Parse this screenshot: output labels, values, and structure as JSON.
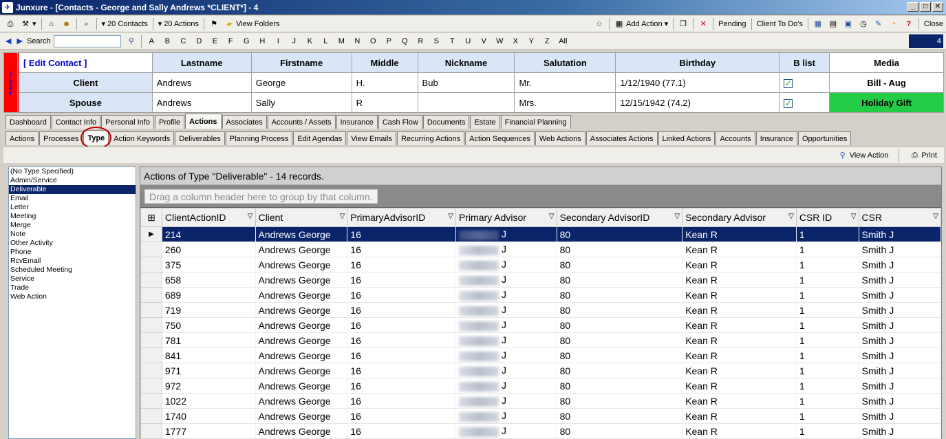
{
  "window": {
    "title": "Junxure - [Contacts - George and Sally Andrews  *CLIENT*] - 4"
  },
  "toolbar1": {
    "contacts": "20 Contacts",
    "actions": "20 Actions",
    "view_folders": "View Folders",
    "add_action": "Add Action",
    "pending": "Pending",
    "client_todos": "Client To Do's",
    "close": "Close"
  },
  "toolbar2": {
    "search_label": "Search",
    "letters": [
      "A",
      "B",
      "C",
      "D",
      "E",
      "F",
      "G",
      "H",
      "I",
      "J",
      "K",
      "L",
      "M",
      "N",
      "O",
      "P",
      "Q",
      "R",
      "S",
      "T",
      "U",
      "V",
      "W",
      "X",
      "Y",
      "Z"
    ],
    "all_label": "All",
    "counter": "4"
  },
  "contact": {
    "alert": "ALERT",
    "edit_label": "[ Edit Contact ]",
    "columns": [
      "Lastname",
      "Firstname",
      "Middle",
      "Nickname",
      "Salutation",
      "Birthday",
      "B list",
      "Media"
    ],
    "client": {
      "role": "Client",
      "last": "Andrews",
      "first": "George",
      "middle": "H.",
      "nick": "Bub",
      "salutation": "Mr.",
      "birthday": "1/12/1940 (77.1)",
      "media": "Bill - Aug"
    },
    "spouse": {
      "role": "Spouse",
      "last": "Andrews",
      "first": "Sally",
      "middle": "R",
      "nick": "",
      "salutation": "Mrs.",
      "birthday": "12/15/1942 (74.2)",
      "media": "Holiday Gift"
    }
  },
  "tabs1": [
    "Dashboard",
    "Contact Info",
    "Personal Info",
    "Profile",
    "Actions",
    "Associates",
    "Accounts / Assets",
    "Insurance",
    "Cash Flow",
    "Documents",
    "Estate",
    "Financial Planning"
  ],
  "tabs2": [
    "Actions",
    "Processes",
    "Type",
    "Action Keywords",
    "Deliverables",
    "Planning Process",
    "Edit Agendas",
    "View Emails",
    "Recurring Actions",
    "Action Sequences",
    "Web Actions",
    "Associates Actions",
    "Linked Actions",
    "Accounts",
    "Insurance",
    "Opportunities"
  ],
  "subbar": {
    "view_action": "View Action",
    "print": "Print"
  },
  "types": [
    "(No Type Specified)",
    "Admin/Service",
    "Deliverable",
    "Email",
    "Letter",
    "Meeting",
    "Merge",
    "Note",
    "Other Activity",
    "Phone",
    "RcvEmail",
    "Scheduled Meeting",
    "Service",
    "Trade",
    "Web Action"
  ],
  "grid": {
    "caption": "Actions of Type \"Deliverable\" - 14 records.",
    "group_hint": "Drag a column header here to group by that column.",
    "columns": [
      "ClientActionID",
      "Client",
      "PrimaryAdvisorID",
      "Primary Advisor",
      "Secondary AdvisorID",
      "Secondary Advisor",
      "CSR ID",
      "CSR"
    ],
    "rows": [
      [
        "214",
        "Andrews George",
        "16",
        "J",
        "80",
        "Kean R",
        "1",
        "Smith J"
      ],
      [
        "260",
        "Andrews George",
        "16",
        "J",
        "80",
        "Kean R",
        "1",
        "Smith J"
      ],
      [
        "375",
        "Andrews George",
        "16",
        "J",
        "80",
        "Kean R",
        "1",
        "Smith J"
      ],
      [
        "658",
        "Andrews George",
        "16",
        "J",
        "80",
        "Kean R",
        "1",
        "Smith J"
      ],
      [
        "689",
        "Andrews George",
        "16",
        "J",
        "80",
        "Kean R",
        "1",
        "Smith J"
      ],
      [
        "719",
        "Andrews George",
        "16",
        "J",
        "80",
        "Kean R",
        "1",
        "Smith J"
      ],
      [
        "750",
        "Andrews George",
        "16",
        "J",
        "80",
        "Kean R",
        "1",
        "Smith J"
      ],
      [
        "781",
        "Andrews George",
        "16",
        "J",
        "80",
        "Kean R",
        "1",
        "Smith J"
      ],
      [
        "841",
        "Andrews George",
        "16",
        "J",
        "80",
        "Kean R",
        "1",
        "Smith J"
      ],
      [
        "971",
        "Andrews George",
        "16",
        "J",
        "80",
        "Kean R",
        "1",
        "Smith J"
      ],
      [
        "972",
        "Andrews George",
        "16",
        "J",
        "80",
        "Kean R",
        "1",
        "Smith J"
      ],
      [
        "1022",
        "Andrews George",
        "16",
        "J",
        "80",
        "Kean R",
        "1",
        "Smith J"
      ],
      [
        "1740",
        "Andrews George",
        "16",
        "J",
        "80",
        "Kean R",
        "1",
        "Smith J"
      ],
      [
        "1777",
        "Andrews George",
        "16",
        "J",
        "80",
        "Kean R",
        "1",
        "Smith J"
      ]
    ]
  }
}
